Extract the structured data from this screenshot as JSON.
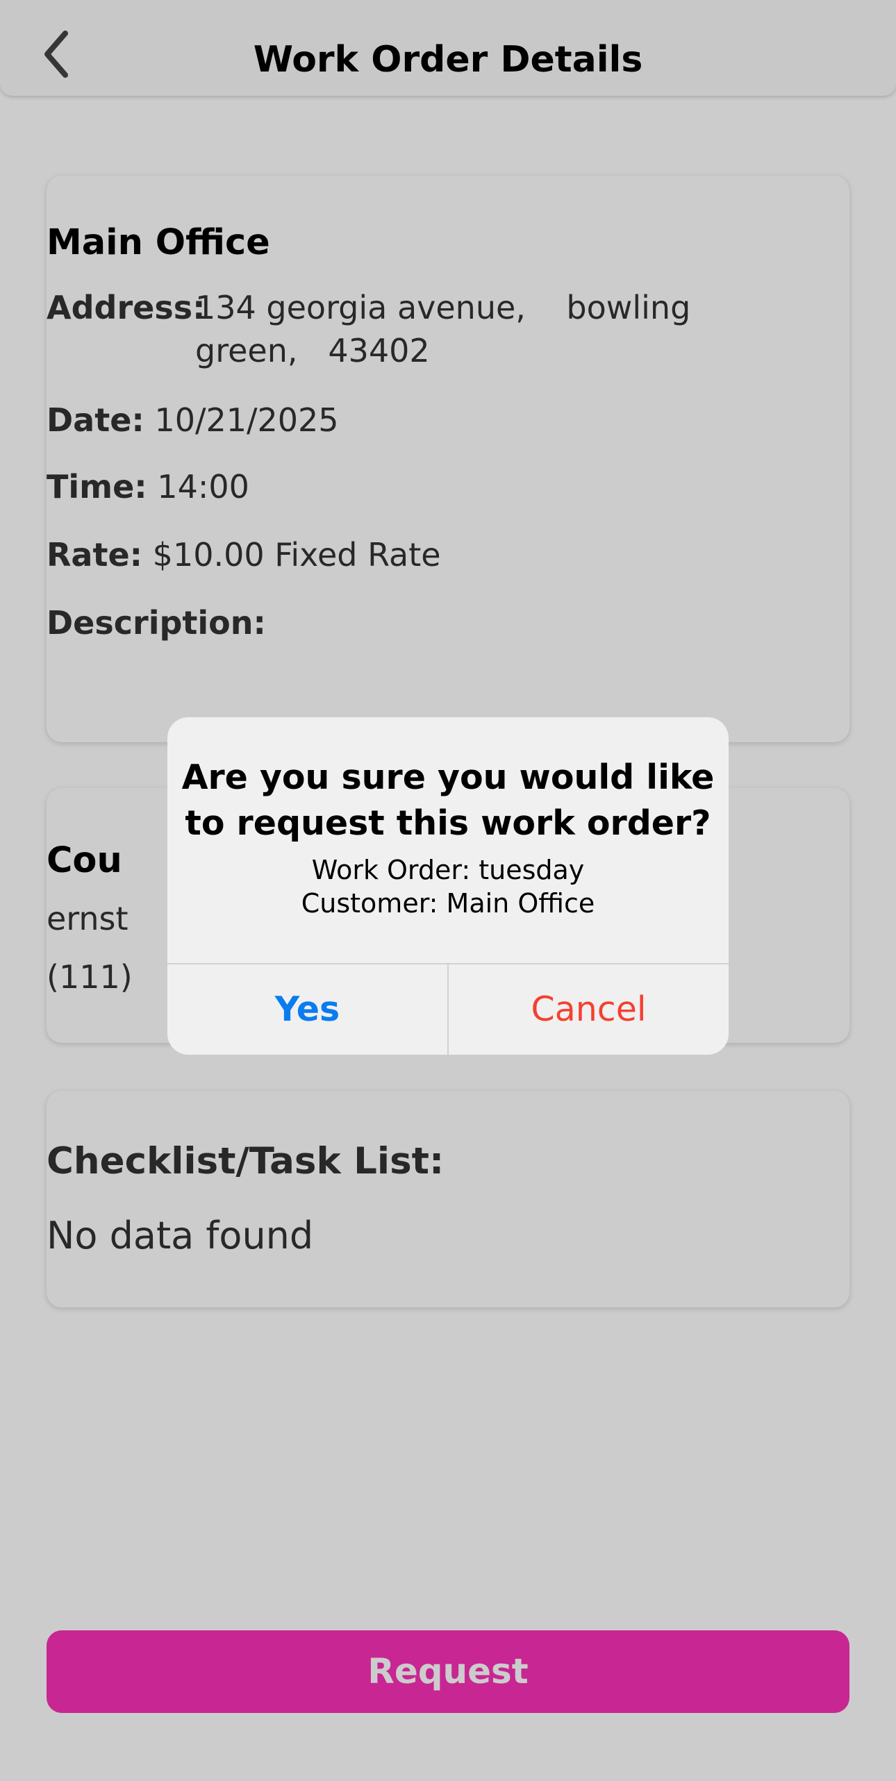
{
  "header": {
    "title": "Work Order Details",
    "back_icon": "chevron-left-icon"
  },
  "work_order": {
    "customer_name": "Main Office",
    "address_label": "Address:",
    "address_value": "134 georgia avenue,    bowling green,   43402",
    "date_label": "Date:",
    "date_value": "10/21/2025",
    "time_label": "Time:",
    "time_value": "14:00",
    "rate_label": "Rate:",
    "rate_value": "$10.00 Fixed Rate",
    "description_label": "Description:"
  },
  "contact": {
    "title_visible": "Cou",
    "line1_visible": "ernst",
    "line2_visible": "(111)"
  },
  "checklist": {
    "title": "Checklist/Task List:",
    "empty_text": "No data found"
  },
  "actions": {
    "request_label": "Request"
  },
  "dialog": {
    "title": "Are you sure you would like to request this work order?",
    "line1": "Work Order: tuesday",
    "line2": "Customer: Main Office",
    "yes_label": "Yes",
    "cancel_label": "Cancel"
  },
  "colors": {
    "accent": "#fb30b8",
    "yes": "#0a7cf0",
    "cancel": "#f53f30",
    "overlay": "rgba(0,0,0,0.2)"
  }
}
